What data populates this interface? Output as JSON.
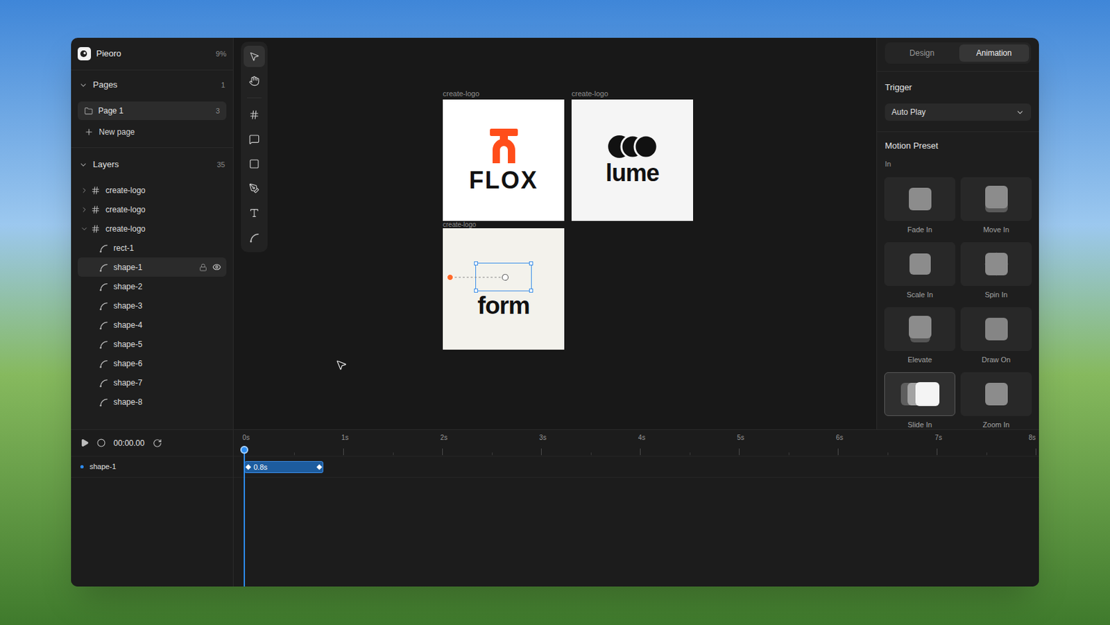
{
  "app": {
    "name": "Pieoro",
    "zoom": "9%"
  },
  "pages": {
    "title": "Pages",
    "count": "1",
    "expanded": true,
    "items": [
      {
        "label": "Page 1",
        "count": "3",
        "selected": true
      }
    ],
    "new_page": "New page"
  },
  "layers": {
    "title": "Layers",
    "count": "35",
    "expanded": true,
    "items": [
      {
        "label": "create-logo",
        "kind": "frame",
        "expanded": false,
        "selected": false,
        "children": []
      },
      {
        "label": "create-logo",
        "kind": "frame",
        "expanded": false,
        "selected": false,
        "children": []
      },
      {
        "label": "create-logo",
        "kind": "frame",
        "expanded": true,
        "selected": false,
        "children": [
          {
            "label": "rect-1",
            "kind": "path",
            "selected": false
          },
          {
            "label": "shape-1",
            "kind": "path",
            "selected": true
          },
          {
            "label": "shape-2",
            "kind": "path",
            "selected": false
          },
          {
            "label": "shape-3",
            "kind": "path",
            "selected": false
          },
          {
            "label": "shape-4",
            "kind": "path",
            "selected": false
          },
          {
            "label": "shape-5",
            "kind": "path",
            "selected": false
          },
          {
            "label": "shape-6",
            "kind": "path",
            "selected": false
          },
          {
            "label": "shape-7",
            "kind": "path",
            "selected": false
          },
          {
            "label": "shape-8",
            "kind": "path",
            "selected": false
          }
        ]
      }
    ]
  },
  "tools": [
    {
      "kind": "select",
      "selected": true
    },
    {
      "kind": "hand",
      "selected": false
    },
    {
      "kind": "frame",
      "selected": false
    },
    {
      "kind": "comment",
      "selected": false
    },
    {
      "kind": "rect",
      "selected": false
    },
    {
      "kind": "pen",
      "selected": false
    },
    {
      "kind": "text",
      "selected": false
    },
    {
      "kind": "path",
      "selected": false
    }
  ],
  "artboards": [
    {
      "label": "create-logo",
      "kind": "flox",
      "logo": "FLOX",
      "selected": false
    },
    {
      "label": "create-logo",
      "kind": "lume",
      "logo": "lume",
      "selected": false
    },
    {
      "label": "create-logo",
      "kind": "form",
      "logo": "form",
      "selected": true
    }
  ],
  "inspector": {
    "tabs": [
      {
        "label": "Design",
        "selected": false
      },
      {
        "label": "Animation",
        "selected": true
      }
    ],
    "trigger": {
      "label": "Trigger",
      "value": "Auto Play"
    },
    "motion_preset": {
      "title": "Motion Preset",
      "group": "In",
      "presets": [
        {
          "label": "Fade In",
          "kind": "fade",
          "selected": false
        },
        {
          "label": "Move In",
          "kind": "move",
          "selected": false
        },
        {
          "label": "Scale In",
          "kind": "scale",
          "selected": false
        },
        {
          "label": "Spin In",
          "kind": "spin",
          "selected": false
        },
        {
          "label": "Elevate",
          "kind": "elevate",
          "selected": false
        },
        {
          "label": "Draw On",
          "kind": "draw",
          "selected": false
        },
        {
          "label": "Slide In",
          "kind": "slide",
          "selected": true
        },
        {
          "label": "Zoom In",
          "kind": "zoom",
          "selected": false
        }
      ]
    }
  },
  "timeline": {
    "time": "00:00.00",
    "playhead": 0,
    "ticks": [
      "0s",
      "1s",
      "2s",
      "3s",
      "4s",
      "5s",
      "6s",
      "7s",
      "8s"
    ],
    "tracks": [
      {
        "name": "shape-1",
        "clips": [
          {
            "label": "0.8s",
            "start": 0,
            "end": 0.8
          }
        ]
      }
    ]
  }
}
